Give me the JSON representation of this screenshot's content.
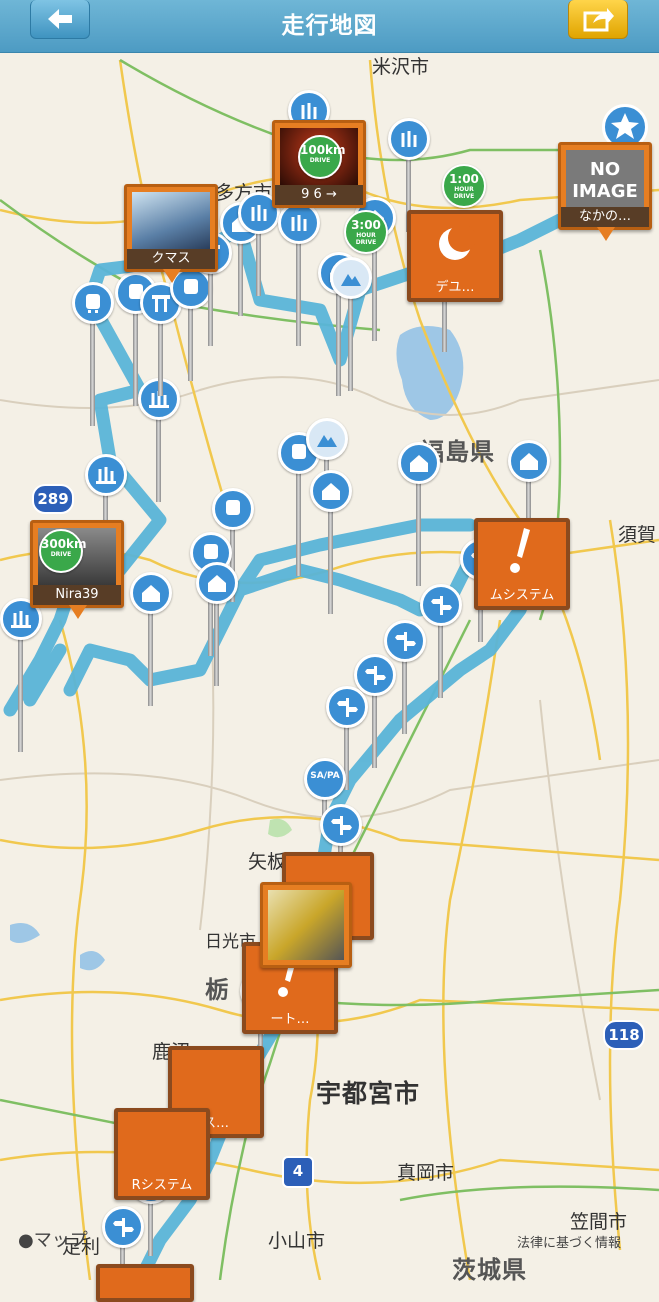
{
  "header": {
    "title": "走行地図",
    "back_icon": "back-arrow-icon",
    "share_icon": "share-icon"
  },
  "colors": {
    "navbar": "#5aa7cf",
    "route": "#5ab4d8",
    "pin": "#3b8fd4",
    "marker_orange": "#e67e22",
    "share_button": "#f2be1c"
  },
  "map": {
    "prefectures": [
      "福島県",
      "栃",
      "茨城県"
    ],
    "cities": [
      "米沢市",
      "多方市",
      "須賀",
      "矢板",
      "日光市",
      "宇都宮市",
      "真岡市",
      "小山市",
      "笠間市",
      "鹿沼",
      "足利"
    ],
    "road_shields": [
      "289",
      "118",
      "4"
    ],
    "markers": [
      {
        "caption": "9 6 →",
        "badge": "100km"
      },
      {
        "caption": "クマス",
        "badge": ""
      },
      {
        "caption": "Nira39",
        "badge": "300km"
      },
      {
        "caption": "デユ…",
        "badge": ""
      },
      {
        "caption": "なかの…",
        "badge": ""
      },
      {
        "caption": "ムシステム",
        "badge": ""
      },
      {
        "caption": "ート…",
        "badge": ""
      },
      {
        "caption": "ス…",
        "badge": ""
      },
      {
        "caption": "Rシステム",
        "badge": ""
      }
    ],
    "no_image_text": "NO IMAGE",
    "badges": [
      {
        "top": "1:00",
        "bottom": "HOUR DRIVE"
      },
      {
        "top": "3:00",
        "bottom": "HOUR DRIVE"
      },
      {
        "top": "100km",
        "bottom": "DRIVE"
      },
      {
        "top": "300km",
        "bottom": "DRIVE"
      }
    ],
    "sapa_label": "SA/PA",
    "attribution": {
      "maps_logo": "マップ",
      "legal": "法律に基づく情報"
    }
  }
}
